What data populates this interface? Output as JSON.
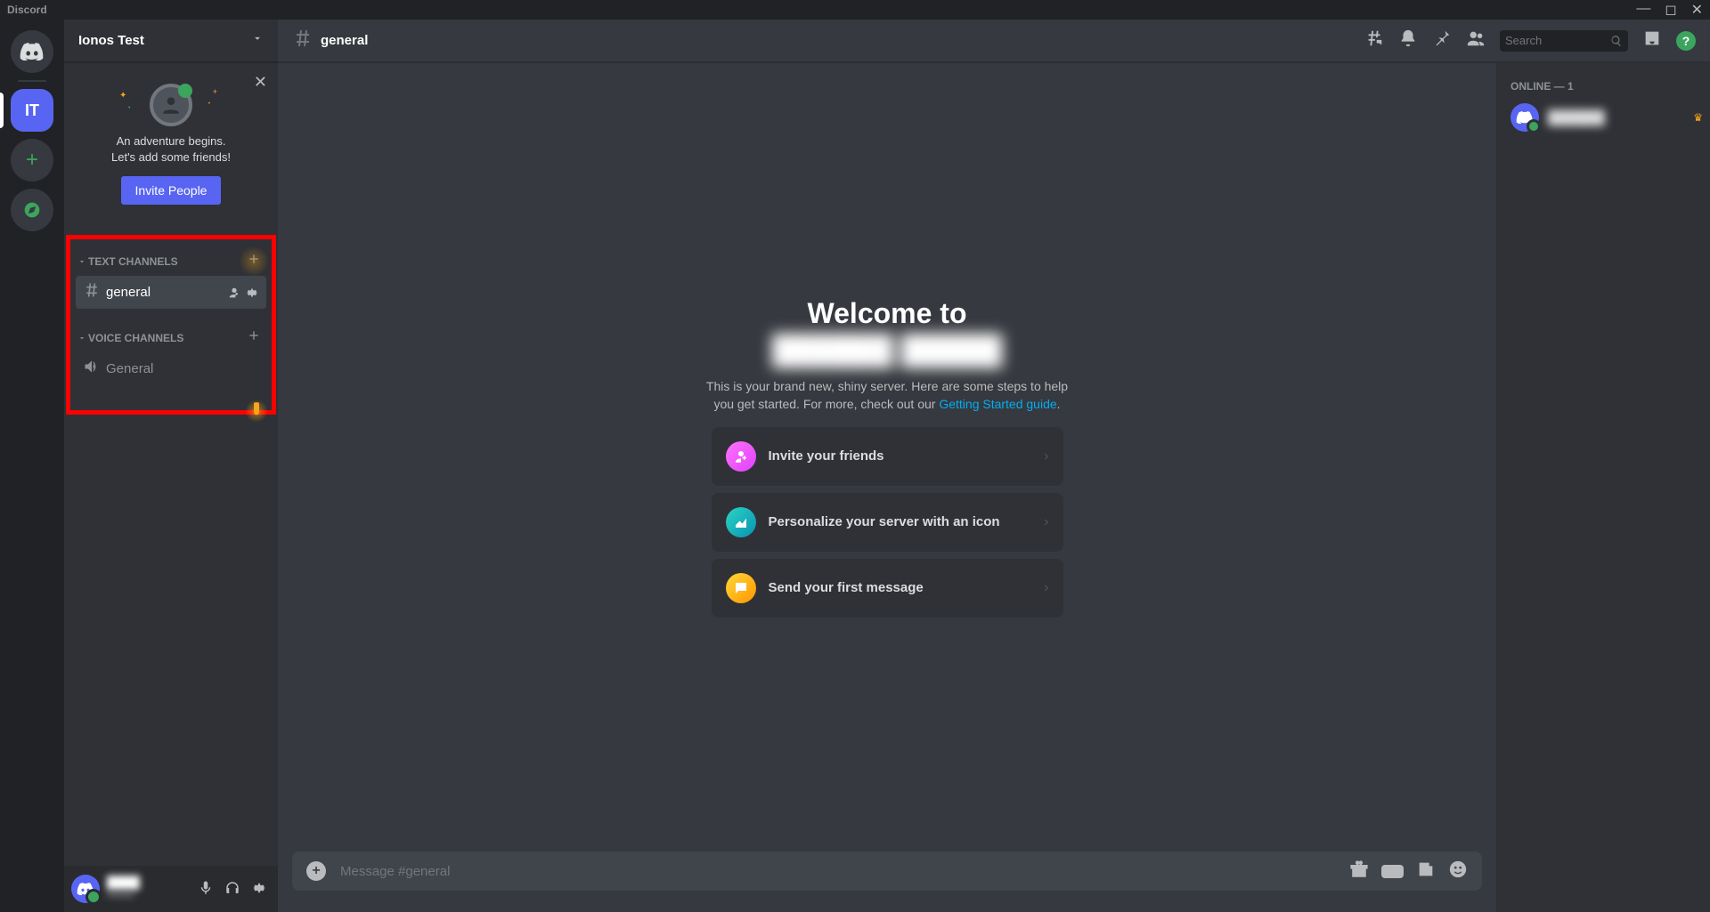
{
  "titlebar": {
    "title": "Discord"
  },
  "server": {
    "name": "Ionos Test",
    "initials": "IT",
    "invite_card": {
      "line1": "An adventure begins.",
      "line2": "Let's add some friends!",
      "button": "Invite People"
    }
  },
  "channels": {
    "text_category": "Text Channels",
    "voice_category": "Voice Channels",
    "general_text": "general",
    "general_voice": "General"
  },
  "chat": {
    "channel": "general",
    "search_placeholder": "Search",
    "welcome_title": "Welcome to",
    "welcome_server": "██████ █████",
    "welcome_sub_1": "This is your brand new, shiny server. Here are some steps to help you get started. For more, check out our ",
    "welcome_sub_link": "Getting Started guide",
    "cards": [
      {
        "label": "Invite your friends"
      },
      {
        "label": "Personalize your server with an icon"
      },
      {
        "label": "Send your first message"
      }
    ],
    "input_placeholder": "Message #general"
  },
  "members": {
    "header": "ONLINE — 1",
    "user": "██████"
  },
  "self": {
    "name": "████",
    "tag": "#0000"
  }
}
